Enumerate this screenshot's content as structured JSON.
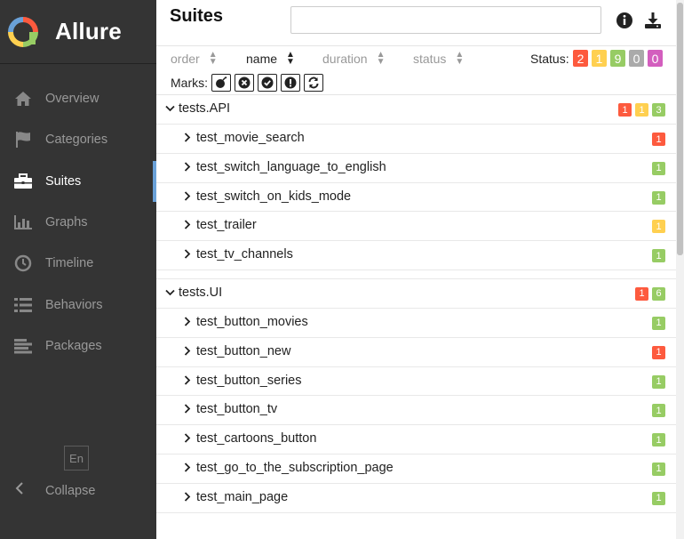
{
  "app": {
    "name": "Allure"
  },
  "sidebar": {
    "items": [
      {
        "label": "Overview",
        "icon": "home-icon",
        "active": false
      },
      {
        "label": "Categories",
        "icon": "flag-icon",
        "active": false
      },
      {
        "label": "Suites",
        "icon": "briefcase-icon",
        "active": true
      },
      {
        "label": "Graphs",
        "icon": "bar-chart-icon",
        "active": false
      },
      {
        "label": "Timeline",
        "icon": "clock-icon",
        "active": false
      },
      {
        "label": "Behaviors",
        "icon": "list-icon",
        "active": false
      },
      {
        "label": "Packages",
        "icon": "align-left-icon",
        "active": false
      }
    ],
    "language": "En",
    "collapse_label": "Collapse"
  },
  "header": {
    "title": "Suites",
    "search_value": ""
  },
  "sort": {
    "order": "order",
    "name": "name",
    "duration": "duration",
    "status": "status"
  },
  "status_filter": {
    "label": "Status:",
    "counts": {
      "failed": "2",
      "broken": "1",
      "passed": "9",
      "skipped": "0",
      "unknown": "0"
    }
  },
  "marks": {
    "label": "Marks:"
  },
  "colors": {
    "failed": "#fd5a3e",
    "broken": "#ffd050",
    "passed": "#97cc64",
    "skipped": "#aaaaaa",
    "unknown": "#d35ebe",
    "sidebar": "#343434",
    "accent": "#6aa1d8"
  },
  "suites": [
    {
      "name": "tests.API",
      "badges": [
        {
          "status": "failed",
          "count": "1"
        },
        {
          "status": "broken",
          "count": "1"
        },
        {
          "status": "passed",
          "count": "3"
        }
      ],
      "tests": [
        {
          "name": "test_movie_search",
          "status": "failed",
          "count": "1"
        },
        {
          "name": "test_switch_language_to_english",
          "status": "passed",
          "count": "1"
        },
        {
          "name": "test_switch_on_kids_mode",
          "status": "passed",
          "count": "1"
        },
        {
          "name": "test_trailer",
          "status": "broken",
          "count": "1"
        },
        {
          "name": "test_tv_channels",
          "status": "passed",
          "count": "1"
        }
      ]
    },
    {
      "name": "tests.UI",
      "badges": [
        {
          "status": "failed",
          "count": "1"
        },
        {
          "status": "passed",
          "count": "6"
        }
      ],
      "tests": [
        {
          "name": "test_button_movies",
          "status": "passed",
          "count": "1"
        },
        {
          "name": "test_button_new",
          "status": "failed",
          "count": "1"
        },
        {
          "name": "test_button_series",
          "status": "passed",
          "count": "1"
        },
        {
          "name": "test_button_tv",
          "status": "passed",
          "count": "1"
        },
        {
          "name": "test_cartoons_button",
          "status": "passed",
          "count": "1"
        },
        {
          "name": "test_go_to_the_subscription_page",
          "status": "passed",
          "count": "1"
        },
        {
          "name": "test_main_page",
          "status": "passed",
          "count": "1"
        }
      ]
    }
  ]
}
